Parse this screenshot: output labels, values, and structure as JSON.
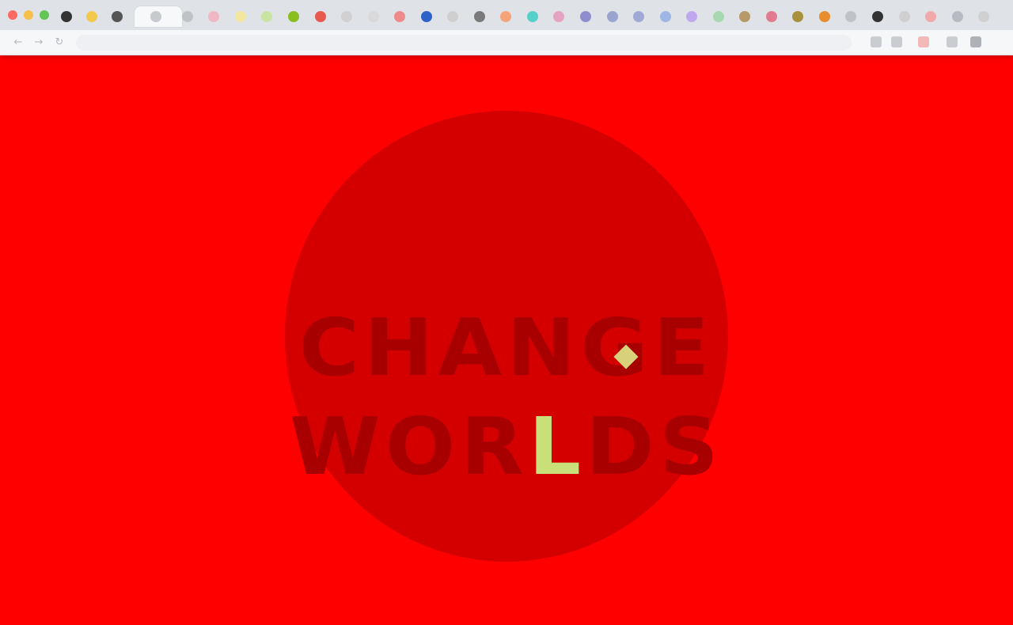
{
  "browser": {
    "window_controls": [
      {
        "name": "close",
        "color": "#ff6b62"
      },
      {
        "name": "minimize",
        "color": "#f7bf4c"
      },
      {
        "name": "maximize",
        "color": "#62c654"
      }
    ],
    "pinned_tab_colors": [
      "#333333",
      "#f2c94c",
      "#555555"
    ],
    "tab_favicon_colors": [
      "#bfc3c8",
      "#f0b8c2",
      "#f3e7a0",
      "#c9e3a1",
      "#8bbf1f",
      "#e85a4f",
      "#d0d0d0",
      "#d9d9d9",
      "#ef8a8a",
      "#2f62c8",
      "#cfcfcf",
      "#7a7a7a",
      "#f4a478",
      "#55d0c8",
      "#e5a3c4",
      "#8e8ecf",
      "#9aa4cf",
      "#a0a8d6",
      "#9fb5e3",
      "#c0a8f0",
      "#a8d8b0",
      "#b89a6a",
      "#e27b8f",
      "#a8903c",
      "#e88c2c",
      "#bfc3c8",
      "#333333",
      "#cfcfcf",
      "#f1a9a9",
      "#b7bbc1",
      "#d0d0d0"
    ],
    "active_tab": {
      "title": "",
      "favicon_color": "#c6c9ce"
    },
    "address_bar": {
      "text": ""
    },
    "toolbar_icon_colors": [
      "#c9ccd1",
      "#c9ccd1",
      "#f3b8b8",
      "#c9ccd1",
      "#aeb2b8"
    ]
  },
  "page": {
    "background": "#ff0000",
    "logo": {
      "line1": [
        "C",
        "H",
        "A",
        "N",
        "G",
        "E"
      ],
      "line2": [
        "W",
        "O",
        "R",
        "L",
        "D",
        "S"
      ],
      "highlight_letter": "L",
      "circle_color": "#d40000",
      "text_color": "#a80000",
      "highlight_color": "#c9e07a"
    }
  }
}
